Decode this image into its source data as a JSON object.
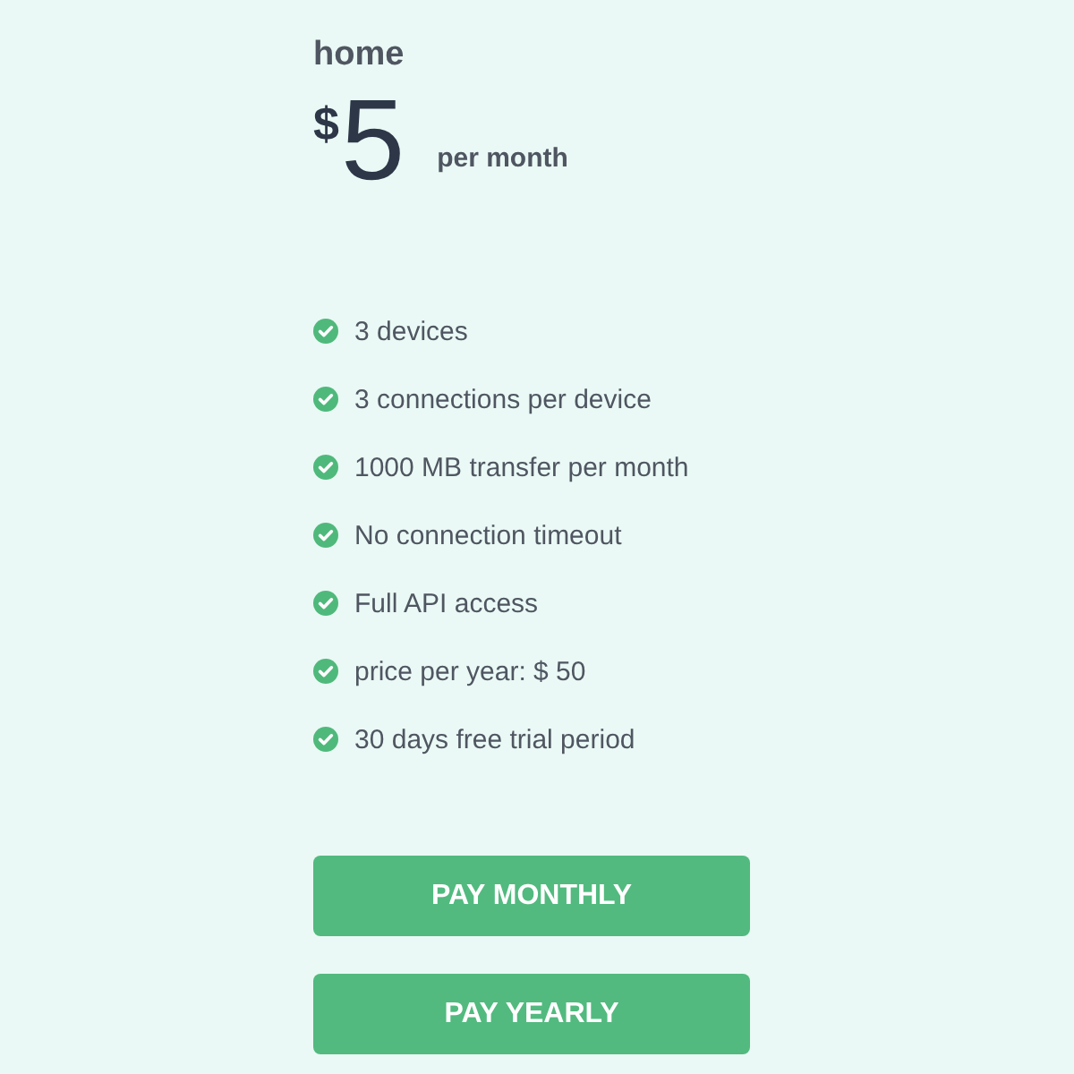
{
  "plan": {
    "name": "home",
    "currency": "$",
    "price": "5",
    "period": "per month"
  },
  "features": [
    "3 devices",
    "3 connections per device",
    "1000 MB transfer per month",
    "No connection timeout",
    "Full API access",
    "price per year: $ 50",
    "30 days free trial period"
  ],
  "buttons": [
    "PAY MONTHLY",
    "PAY YEARLY"
  ]
}
